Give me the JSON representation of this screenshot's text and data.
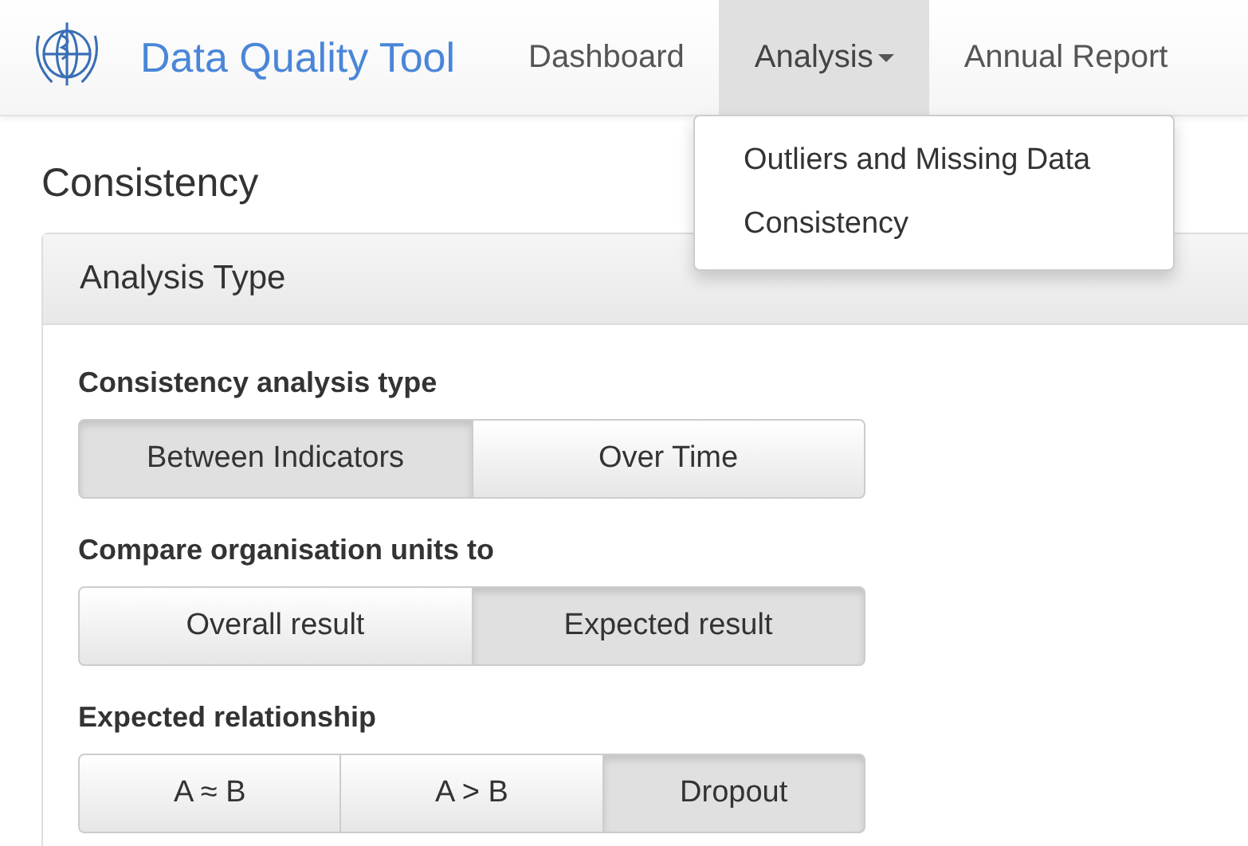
{
  "navbar": {
    "brand": "Data Quality Tool",
    "items": [
      {
        "label": "Dashboard",
        "selected": false,
        "dropdown": false
      },
      {
        "label": "Analysis",
        "selected": true,
        "dropdown": true
      },
      {
        "label": "Annual Report",
        "selected": false,
        "dropdown": false
      }
    ]
  },
  "dropdown_menu": {
    "expanded": true,
    "items": [
      "Outliers and Missing Data",
      "Consistency"
    ]
  },
  "page_title": "Consistency",
  "panel": {
    "title": "Analysis Type",
    "groups": [
      {
        "label": "Consistency analysis type",
        "options": [
          {
            "label": "Between Indicators",
            "selected": true
          },
          {
            "label": "Over Time",
            "selected": false
          }
        ]
      },
      {
        "label": "Compare organisation units to",
        "options": [
          {
            "label": "Overall result",
            "selected": false
          },
          {
            "label": "Expected result",
            "selected": true
          }
        ]
      },
      {
        "label": "Expected relationship",
        "options": [
          {
            "label": "A ≈ B",
            "selected": false
          },
          {
            "label": "A > B",
            "selected": false
          },
          {
            "label": "Dropout",
            "selected": true
          }
        ]
      }
    ]
  }
}
